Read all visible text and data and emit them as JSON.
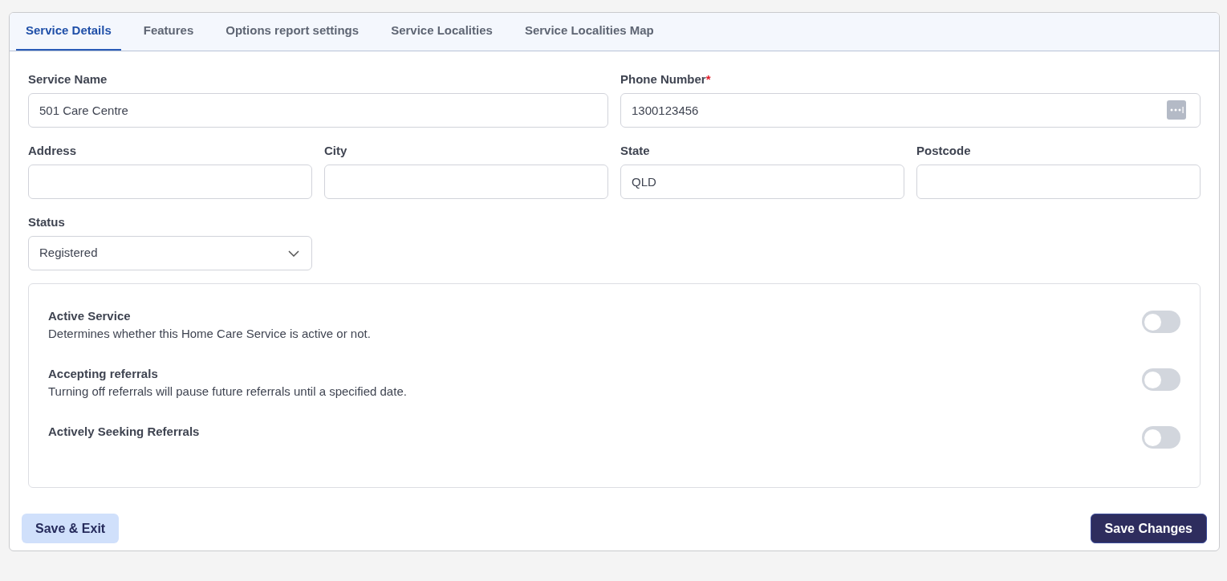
{
  "tabs": [
    {
      "label": "Service Details",
      "selected": true
    },
    {
      "label": "Features",
      "selected": false
    },
    {
      "label": "Options report settings",
      "selected": false
    },
    {
      "label": "Service Localities",
      "selected": false
    },
    {
      "label": "Service Localities Map",
      "selected": false
    }
  ],
  "field_rows": [
    [
      {
        "kind": "text",
        "label": "Service Name",
        "value": "501 Care Centre"
      },
      {
        "kind": "text",
        "label": "Phone Number",
        "required_mark": "*",
        "value": "1300123456",
        "addon": true
      }
    ],
    [
      {
        "kind": "text",
        "label": "Address"
      },
      {
        "kind": "text",
        "label": "City"
      },
      {
        "kind": "text",
        "label": "State",
        "value": "QLD"
      },
      {
        "kind": "text",
        "label": "Postcode"
      }
    ],
    [
      {
        "kind": "select",
        "label": "Status",
        "value": "Registered"
      }
    ]
  ],
  "toggles": [
    {
      "title": "Active Service",
      "description": "Determines whether this Home Care Service is active or not.",
      "on": false
    },
    {
      "title": "Accepting referrals",
      "description": "Turning off referrals will pause future referrals until a specified date.",
      "on": false
    },
    {
      "title": "Actively Seeking Referrals",
      "on": false
    }
  ],
  "buttons": [
    {
      "label": "Save & Exit",
      "kind": "secondary"
    },
    {
      "label": "Save Changes",
      "kind": "primary"
    }
  ]
}
